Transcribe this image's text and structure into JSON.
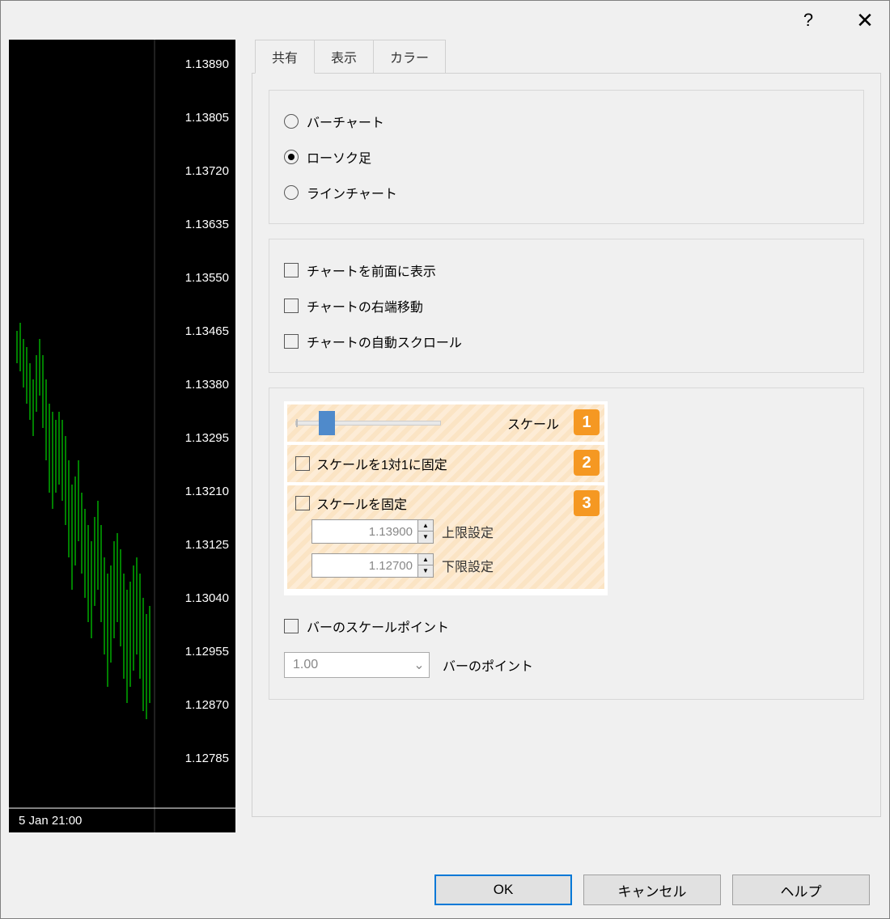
{
  "titlebar": {
    "help": "?",
    "close": "✕"
  },
  "chart_data": {
    "type": "bar",
    "title": "",
    "xlabel": "5 Jan 21:00",
    "ylabel": "",
    "ylim": [
      1.127,
      1.139
    ],
    "y_ticks": [
      "1.13890",
      "1.13805",
      "1.13720",
      "1.13635",
      "1.13550",
      "1.13465",
      "1.13380",
      "1.13295",
      "1.13210",
      "1.13125",
      "1.13040",
      "1.12955",
      "1.12870",
      "1.12785"
    ],
    "values": []
  },
  "tabs": {
    "share": "共有",
    "display": "表示",
    "color": "カラー"
  },
  "radios": {
    "bar": "バーチャート",
    "candle": "ローソク足",
    "line": "ラインチャート"
  },
  "checks": {
    "foreground": "チャートを前面に表示",
    "right_shift": "チャートの右端移動",
    "auto_scroll": "チャートの自動スクロール",
    "scale_label": "スケール",
    "scale_fix_1to1": "スケールを1対1に固定",
    "scale_fix": "スケールを固定",
    "upper_label": "上限設定",
    "lower_label": "下限設定",
    "upper_value": "1.13900",
    "lower_value": "1.12700",
    "bar_scale_point": "バーのスケールポイント",
    "bar_point_label": "バーのポイント",
    "bar_point_value": "1.00"
  },
  "badges": {
    "b1": "1",
    "b2": "2",
    "b3": "3"
  },
  "buttons": {
    "ok": "OK",
    "cancel": "キャンセル",
    "help": "ヘルプ"
  }
}
